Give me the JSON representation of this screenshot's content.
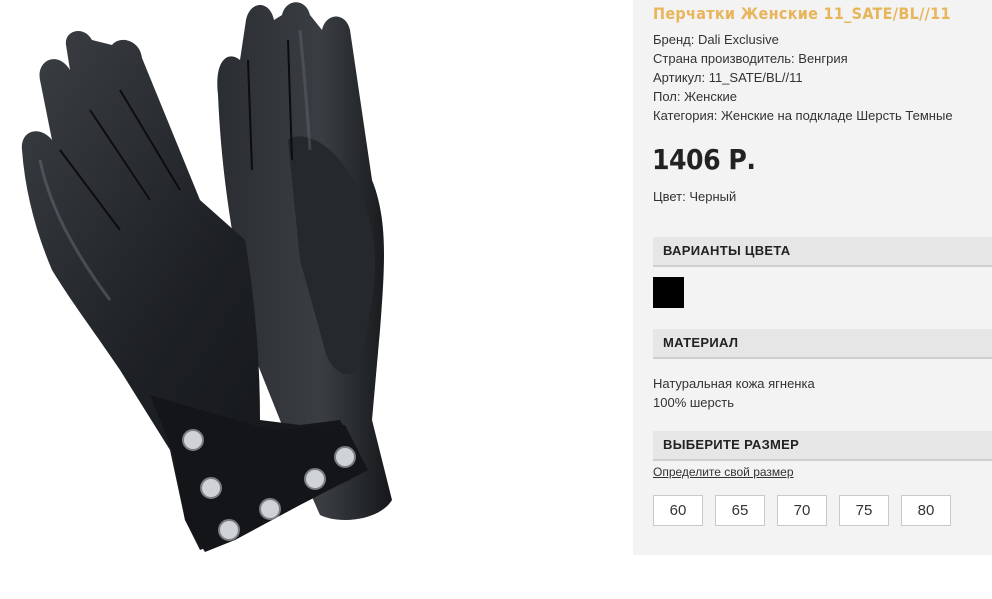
{
  "product": {
    "title": "Перчатки Женские 11_SATE/BL//11",
    "specs": {
      "brand": "Бренд: Dali Exclusive",
      "country": "Страна производитель: Венгрия",
      "article": "Артикул: 11_SATE/BL//11",
      "gender": "Пол: Женские",
      "category": "Категория: Женские на подкладе Шерсть Темные"
    },
    "price": "1406 Р.",
    "color": "Цвет: Черный",
    "image_alt": "black-leather-gloves-with-studded-cuff"
  },
  "color_variants": {
    "header": "ВАРИАНТЫ ЦВЕТА",
    "swatches": [
      {
        "name": "black",
        "color": "#000000"
      }
    ]
  },
  "material": {
    "header": "МАТЕРИАЛ",
    "line1": "Натуральная кожа ягненка",
    "line2": "100% шерсть"
  },
  "size": {
    "header": "ВЫБЕРИТЕ РАЗМЕР",
    "help_link": "Определите свой размер",
    "options": [
      "60",
      "65",
      "70",
      "75",
      "80"
    ]
  },
  "colors": {
    "title_accent": "#e8b55a",
    "panel_bg": "#f3f3f3",
    "section_bg": "#e6e6e6"
  }
}
